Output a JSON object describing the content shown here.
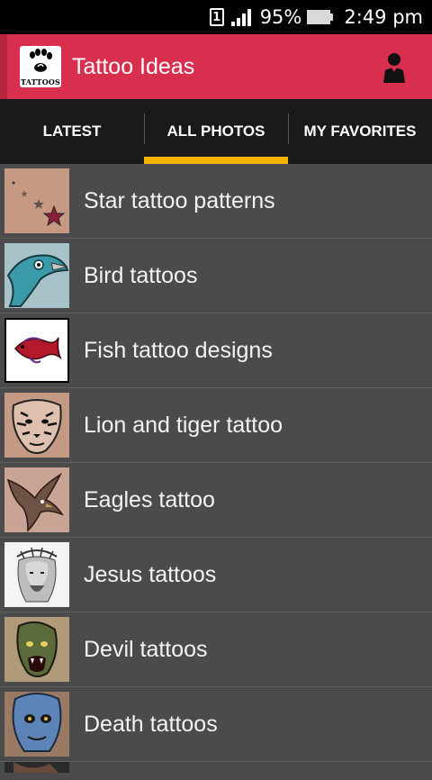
{
  "status": {
    "sim_slot": "1",
    "battery": "95%",
    "time": "2:49 pm"
  },
  "app": {
    "logo_text": "TATTOOS",
    "title": "Tattoo Ideas",
    "account_icon": "account-icon"
  },
  "tabs": [
    {
      "label": "LATEST"
    },
    {
      "label": "ALL PHOTOS",
      "active": true
    },
    {
      "label": "MY FAVORITES"
    }
  ],
  "items": [
    {
      "label": "Star tattoo patterns"
    },
    {
      "label": "Bird tattoos"
    },
    {
      "label": "Fish tattoo designs"
    },
    {
      "label": "Lion and tiger tattoo"
    },
    {
      "label": "Eagles tattoo"
    },
    {
      "label": "Jesus tattoos"
    },
    {
      "label": "Devil tattoos"
    },
    {
      "label": "Death tattoos"
    }
  ],
  "colors": {
    "app_bar": "#d92f4e",
    "tab_indicator": "#f5b400",
    "list_background": "#4b4b4b"
  }
}
